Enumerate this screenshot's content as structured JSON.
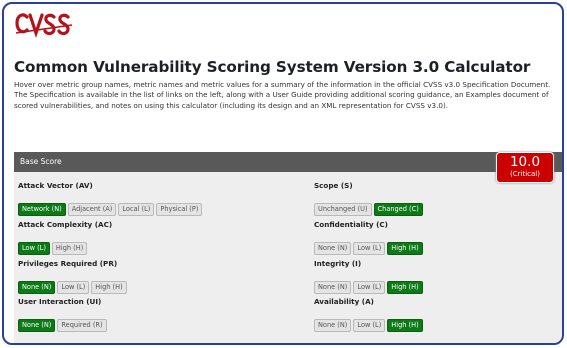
{
  "logo_text": "CVSS",
  "title": "Common Vulnerability Scoring System Version 3.0 Calculator",
  "intro": "Hover over metric group names, metric names and metric values for a summary of the information in the official CVSS v3.0 Specification Document. The Specification is available in the list of links on the left, along with a User Guide providing additional scoring guidance, an Examples document of scored vulnerabilities, and notes on using this calculator (including its design and an XML representation for CVSS v3.0).",
  "base_score": {
    "header": "Base Score",
    "value": "10.0",
    "severity": "(Critical)"
  },
  "metrics": {
    "av": {
      "label": "Attack Vector (AV)",
      "options": [
        "Network (N)",
        "Adjacent (A)",
        "Local (L)",
        "Physical (P)"
      ],
      "selected": "Network (N)"
    },
    "ac": {
      "label": "Attack Complexity (AC)",
      "options": [
        "Low (L)",
        "High (H)"
      ],
      "selected": "Low (L)"
    },
    "pr": {
      "label": "Privileges Required (PR)",
      "options": [
        "None (N)",
        "Low (L)",
        "High (H)"
      ],
      "selected": "None (N)"
    },
    "ui": {
      "label": "User Interaction (UI)",
      "options": [
        "None (N)",
        "Required (R)"
      ],
      "selected": "None (N)"
    },
    "s": {
      "label": "Scope (S)",
      "options": [
        "Unchanged (U)",
        "Changed (C)"
      ],
      "selected": "Changed (C)"
    },
    "c": {
      "label": "Confidentiality (C)",
      "options": [
        "None (N)",
        "Low (L)",
        "High (H)"
      ],
      "selected": "High (H)"
    },
    "i": {
      "label": "Integrity (I)",
      "options": [
        "None (N)",
        "Low (L)",
        "High (H)"
      ],
      "selected": "High (H)"
    },
    "a": {
      "label": "Availability (A)",
      "options": [
        "None (N)",
        "Low (L)",
        "High (H)"
      ],
      "selected": "High (H)"
    }
  },
  "colors": {
    "selected": "#0c7a16",
    "critical": "#cc0000",
    "panel_header": "#595959",
    "frame_border": "#2b3f9c",
    "logo_red": "#b5121b"
  }
}
